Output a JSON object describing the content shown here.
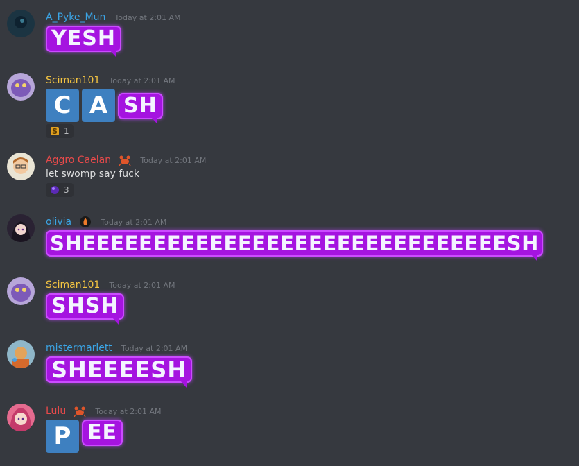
{
  "messages": [
    {
      "username": "A_Pyke_Mun",
      "name_color": "#3ba5e6",
      "timestamp": "Today at 2:01 AM",
      "bubble_text": "YESH"
    },
    {
      "username": "Sciman101",
      "name_color": "#f5c542",
      "timestamp": "Today at 2:01 AM",
      "emoji_letters": [
        "C",
        "A"
      ],
      "bubble_text": "SH",
      "reaction": {
        "icon": "gold-s-icon",
        "count": "1"
      }
    },
    {
      "username": "Aggro Caelan",
      "name_color": "#e84a4a",
      "badge_icon": "crab-icon",
      "timestamp": "Today at 2:01 AM",
      "text": "let swomp say fuck",
      "reaction": {
        "icon": "purple-orb-icon",
        "count": "3"
      }
    },
    {
      "username": "olivia",
      "name_color": "#3ba5e6",
      "badge_icon": "fire-badge-icon",
      "timestamp": "Today at 2:01 AM",
      "bubble_text": "SHEEEEEEEEEEEEEEEEEEEEEEEEEEEEEESH"
    },
    {
      "username": "Sciman101",
      "name_color": "#f5c542",
      "timestamp": "Today at 2:01 AM",
      "bubble_text": "SHSH"
    },
    {
      "username": "mistermarlett",
      "name_color": "#3ba5e6",
      "timestamp": "Today at 2:01 AM",
      "bubble_text": "SHEEEESH"
    },
    {
      "username": "Lulu",
      "name_color": "#e84a4a",
      "badge_icon": "crab-icon",
      "timestamp": "Today at 2:01 AM",
      "emoji_letters": [
        "P"
      ],
      "bubble_text": "EE"
    }
  ]
}
